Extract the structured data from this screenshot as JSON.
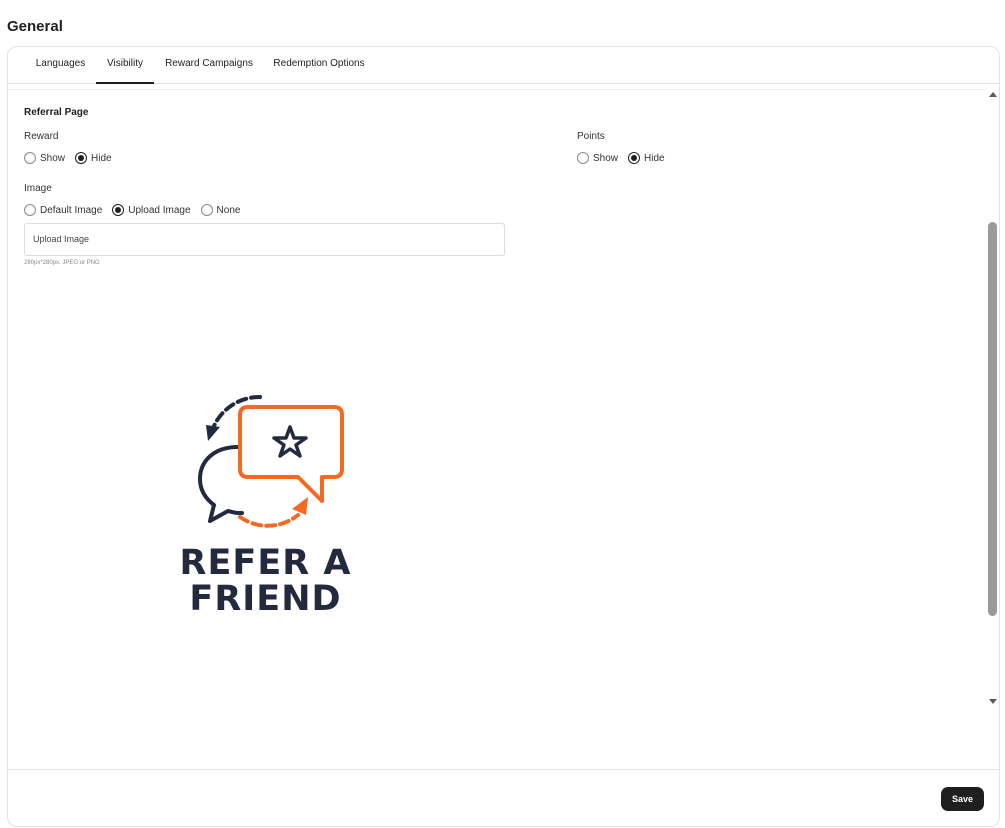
{
  "page": {
    "title": "General"
  },
  "tabs": [
    {
      "label": "Languages",
      "active": false
    },
    {
      "label": "Visibility",
      "active": true
    },
    {
      "label": "Reward Campaigns",
      "active": false
    },
    {
      "label": "Redemption Options",
      "active": false
    }
  ],
  "referral": {
    "section_title": "Referral Page",
    "reward": {
      "label": "Reward",
      "options": [
        "Show",
        "Hide"
      ],
      "selected": "Hide"
    },
    "points": {
      "label": "Points",
      "options": [
        "Show",
        "Hide"
      ],
      "selected": "Hide"
    },
    "image": {
      "label": "Image",
      "options": [
        "Default Image",
        "Upload Image",
        "None"
      ],
      "selected": "Upload Image",
      "upload_label": "Upload Image",
      "hint": "280px*280px. JPEG or PNG"
    },
    "preview_image": {
      "line1": "REFER A",
      "line2": "FRIEND",
      "colors": {
        "dark": "#232a3d",
        "accent": "#f26a24"
      }
    }
  },
  "footer": {
    "save_label": "Save"
  }
}
